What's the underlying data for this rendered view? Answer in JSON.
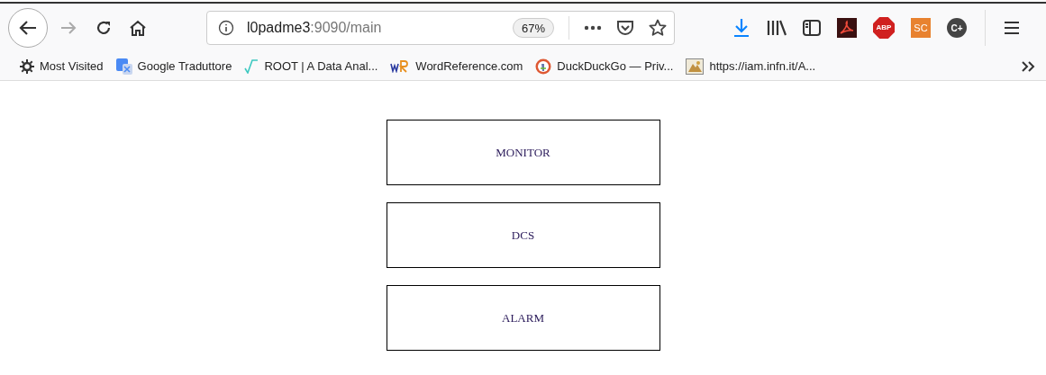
{
  "toolbar": {
    "url_host": "l0padme3",
    "url_path": ":9090/main",
    "zoom": "67%",
    "extensions": [
      {
        "kind": "download"
      },
      {
        "kind": "library"
      },
      {
        "kind": "sidebar"
      },
      {
        "kind": "acrobat"
      },
      {
        "kind": "abp",
        "label": "ABP"
      },
      {
        "kind": "sc",
        "label": "SC"
      },
      {
        "kind": "cplus",
        "label": "C+"
      }
    ]
  },
  "bookmarks": [
    {
      "kind": "gear",
      "label": "Most Visited"
    },
    {
      "kind": "translate",
      "label": "Google Traduttore"
    },
    {
      "kind": "root",
      "label": "ROOT | A Data Anal..."
    },
    {
      "kind": "wr",
      "label": "WordReference.com"
    },
    {
      "kind": "duck",
      "label": "DuckDuckGo — Priv..."
    },
    {
      "kind": "image",
      "label": "https://iam.infn.it/A..."
    }
  ],
  "menu_buttons": [
    {
      "label": "MONITOR"
    },
    {
      "label": "DCS"
    },
    {
      "label": "ALARM"
    }
  ]
}
